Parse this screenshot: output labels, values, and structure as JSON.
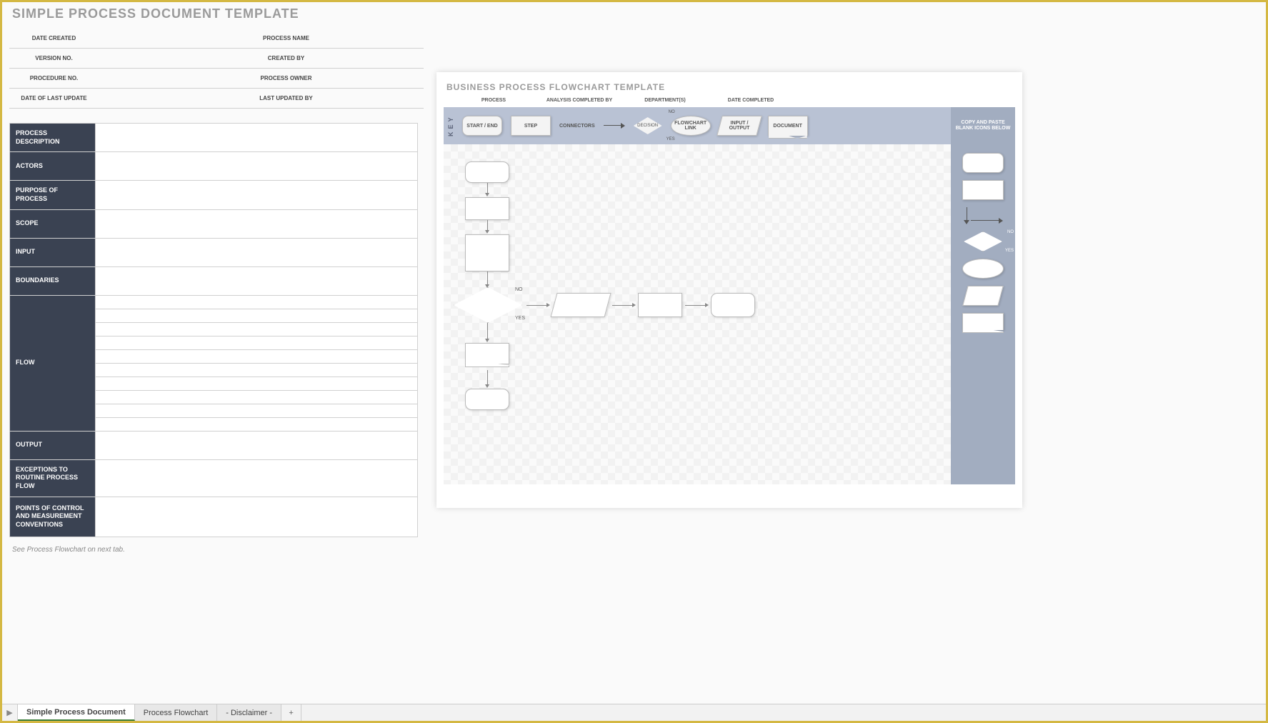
{
  "doc": {
    "title": "SIMPLE PROCESS DOCUMENT TEMPLATE",
    "footnote": "See Process Flowchart on next tab.",
    "header_labels": {
      "date_created": "DATE CREATED",
      "process_name": "PROCESS NAME",
      "version_no": "VERSION NO.",
      "created_by": "CREATED BY",
      "procedure_no": "PROCEDURE NO.",
      "process_owner": "PROCESS OWNER",
      "date_last_update": "DATE OF LAST UPDATE",
      "last_updated_by": "LAST UPDATED BY"
    },
    "rows": {
      "process_description": "PROCESS DESCRIPTION",
      "actors": "ACTORS",
      "purpose": "PURPOSE OF PROCESS",
      "scope": "SCOPE",
      "input": "INPUT",
      "boundaries": "BOUNDARIES",
      "flow": "FLOW",
      "output": "OUTPUT",
      "exceptions": "EXCEPTIONS TO ROUTINE PROCESS FLOW",
      "points": "POINTS OF CONTROL AND MEASUREMENT CONVENTIONS"
    }
  },
  "flowchart": {
    "title": "BUSINESS PROCESS FLOWCHART TEMPLATE",
    "columns": {
      "process": "PROCESS",
      "analysis": "ANALYSIS COMPLETED BY",
      "departments": "DEPARTMENT(S)",
      "date": "DATE COMPLETED"
    },
    "key": {
      "label": "KEY",
      "start_end": "START / END",
      "step": "STEP",
      "connectors": "CONNECTORS",
      "decision": "DECISION",
      "no": "NO",
      "yes": "YES",
      "flowchart_link": "FLOWCHART LINK",
      "io": "INPUT / OUTPUT",
      "document": "DOCUMENT",
      "blank_text": "COPY AND PASTE BLANK ICONS BELOW"
    },
    "canvas_labels": {
      "no": "NO",
      "yes": "YES"
    }
  },
  "tabs": {
    "t1": "Simple Process Document",
    "t2": "Process Flowchart",
    "t3": "- Disclaimer -"
  }
}
